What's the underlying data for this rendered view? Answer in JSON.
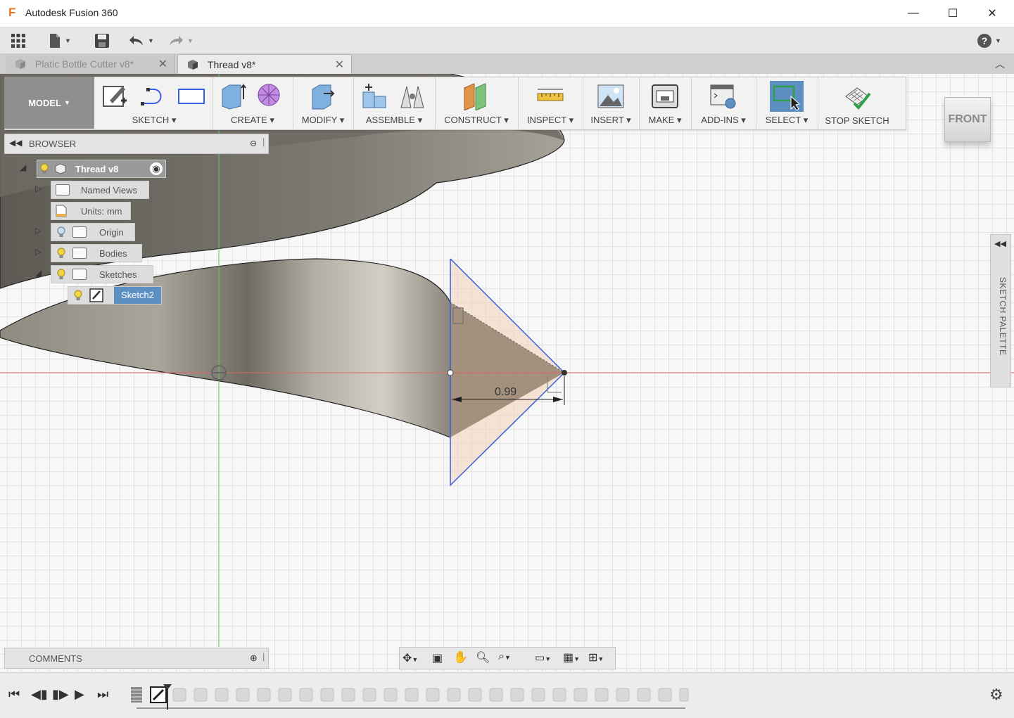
{
  "window": {
    "title": "Autodesk Fusion 360",
    "logo": "F",
    "minimize": "—",
    "maximize": "☐",
    "close": "✕"
  },
  "tabs": [
    {
      "label": "Platic Bottle Cutter v8*",
      "active": false
    },
    {
      "label": "Thread v8*",
      "active": true
    }
  ],
  "toolbar": {
    "workspace": "MODEL",
    "groups": [
      "SKETCH",
      "CREATE",
      "MODIFY",
      "ASSEMBLE",
      "CONSTRUCT",
      "INSPECT",
      "INSERT",
      "MAKE",
      "ADD-INS",
      "SELECT",
      "STOP SKETCH"
    ]
  },
  "viewcube": {
    "face": "FRONT"
  },
  "browser": {
    "title": "BROWSER",
    "root": "Thread v8",
    "nodes": [
      "Named Views",
      "Units: mm",
      "Origin",
      "Bodies",
      "Sketches",
      "Sketch2"
    ]
  },
  "palette": {
    "label": "SKETCH PALETTE"
  },
  "comments": {
    "title": "COMMENTS"
  },
  "dimension": {
    "value": "0.99"
  },
  "colors": {
    "accent": "#4a7fb5",
    "sketch_line": "#3a5ee0",
    "axis_x": "#e06666",
    "axis_y": "#66cc66",
    "selected": "#5e8fc3"
  }
}
